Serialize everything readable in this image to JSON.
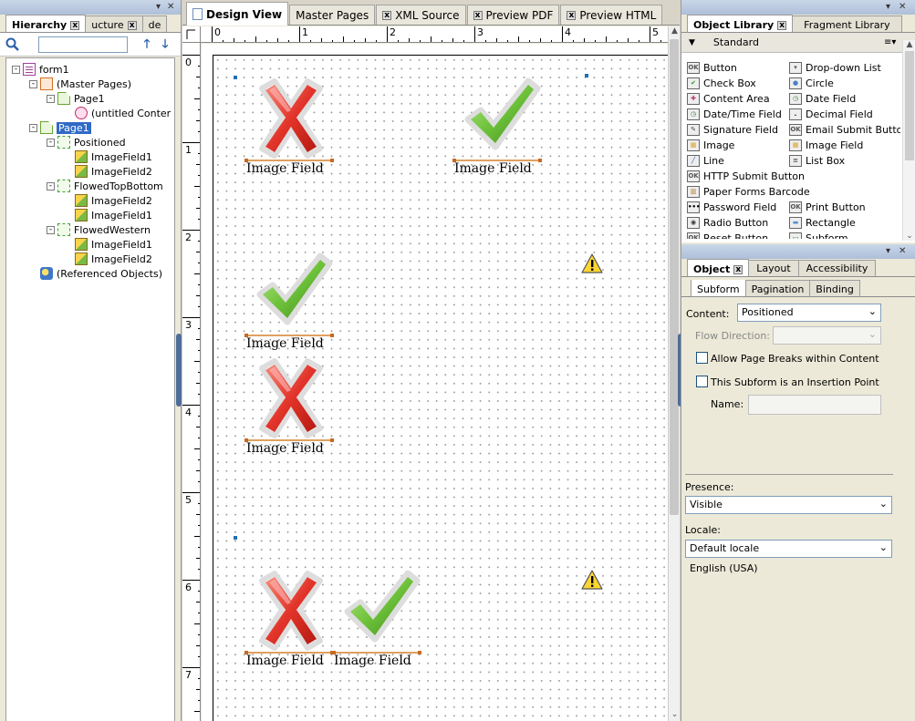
{
  "hierarchy_panel": {
    "tabs": [
      {
        "label": "Hierarchy",
        "closable": true,
        "active": true
      },
      {
        "label": "ucture",
        "closable": true,
        "active": false
      },
      {
        "label": "de",
        "closable": false,
        "active": false
      }
    ],
    "tree": [
      {
        "label": "form1",
        "icon": "form-icon",
        "toggle": "-",
        "depth": 0
      },
      {
        "label": "(Master Pages)",
        "icon": "master-pages-icon",
        "toggle": "-",
        "depth": 1
      },
      {
        "label": "Page1",
        "icon": "page-icon",
        "toggle": "-",
        "depth": 2
      },
      {
        "label": "(untitled Conter",
        "icon": "content-area-icon",
        "toggle": "",
        "depth": 3
      },
      {
        "label": "Page1",
        "icon": "page-icon",
        "toggle": "-",
        "depth": 1,
        "selected": true
      },
      {
        "label": "Positioned",
        "icon": "subform-icon",
        "toggle": "-",
        "depth": 2
      },
      {
        "label": "ImageField1",
        "icon": "image-field-icon",
        "toggle": "",
        "depth": 3
      },
      {
        "label": "ImageField2",
        "icon": "image-field-icon",
        "toggle": "",
        "depth": 3
      },
      {
        "label": "FlowedTopBottom",
        "icon": "subform-icon",
        "toggle": "-",
        "depth": 2
      },
      {
        "label": "ImageField2",
        "icon": "image-field-icon",
        "toggle": "",
        "depth": 3
      },
      {
        "label": "ImageField1",
        "icon": "image-field-icon",
        "toggle": "",
        "depth": 3
      },
      {
        "label": "FlowedWestern",
        "icon": "subform-icon",
        "toggle": "-",
        "depth": 2
      },
      {
        "label": "ImageField1",
        "icon": "image-field-icon",
        "toggle": "",
        "depth": 3
      },
      {
        "label": "ImageField2",
        "icon": "image-field-icon",
        "toggle": "",
        "depth": 3
      },
      {
        "label": "(Referenced Objects)",
        "icon": "referenced-objects-icon",
        "toggle": "",
        "depth": 1
      }
    ]
  },
  "doc_tabs": [
    {
      "label": "Design View",
      "active": true,
      "icon": "page-icon",
      "closable": false
    },
    {
      "label": "Master Pages",
      "active": false,
      "closable": false
    },
    {
      "label": "XML Source",
      "active": false,
      "closable": true
    },
    {
      "label": "Preview PDF",
      "active": false,
      "closable": true
    },
    {
      "label": "Preview HTML",
      "active": false,
      "closable": true
    }
  ],
  "rulers": {
    "horizontal": [
      "0",
      "1",
      "2",
      "3",
      "4",
      "5"
    ],
    "vertical": [
      "0",
      "1",
      "2",
      "3",
      "4",
      "5",
      "6",
      "7"
    ]
  },
  "canvas": {
    "fields": [
      {
        "caption": "Image Field",
        "image": "red-x"
      },
      {
        "caption": "Image Field",
        "image": "green-check"
      },
      {
        "caption": "Image Field",
        "image": "green-check"
      },
      {
        "caption": "Image Field",
        "image": "red-x"
      },
      {
        "caption": "Image Field",
        "image": "red-x"
      },
      {
        "caption": "Image Field",
        "image": "green-check"
      }
    ]
  },
  "object_library": {
    "tabs": [
      {
        "label": "Object Library",
        "active": true,
        "closable": true
      },
      {
        "label": "Fragment Library",
        "active": false,
        "closable": false
      }
    ],
    "group": "Standard",
    "items": [
      [
        "Button",
        "Drop-down List"
      ],
      [
        "Check Box",
        "Circle"
      ],
      [
        "Content Area",
        "Date Field"
      ],
      [
        "Date/Time Field",
        "Decimal Field"
      ],
      [
        "Signature Field",
        "Email Submit Button"
      ],
      [
        "Image",
        "Image Field"
      ],
      [
        "Line",
        "List Box"
      ],
      [
        "HTTP Submit Button",
        ""
      ],
      [
        "Paper Forms Barcode",
        ""
      ],
      [
        "Password Field",
        "Print Button"
      ],
      [
        "Radio Button",
        "Rectangle"
      ],
      [
        "Reset Button",
        "Subform"
      ]
    ],
    "item_icons": [
      [
        "OK",
        "▾"
      ],
      [
        "✔",
        "●"
      ],
      [
        "✚",
        "◷"
      ],
      [
        "◷",
        "."
      ],
      [
        "✎",
        "OK"
      ],
      [
        "▦",
        "▦"
      ],
      [
        "╱",
        "≡"
      ],
      [
        "OK",
        ""
      ],
      [
        "▥",
        ""
      ],
      [
        "•••",
        "OK"
      ],
      [
        "◉",
        "▬"
      ],
      [
        "OK",
        "▭"
      ]
    ]
  },
  "properties": {
    "tabs": [
      {
        "label": "Object",
        "active": true,
        "closable": true
      },
      {
        "label": "Layout",
        "active": false
      },
      {
        "label": "Accessibility",
        "active": false
      }
    ],
    "subtabs": [
      {
        "label": "Subform",
        "active": true
      },
      {
        "label": "Pagination",
        "active": false
      },
      {
        "label": "Binding",
        "active": false
      }
    ],
    "content_label": "Content:",
    "content_value": "Positioned",
    "flow_direction_label": "Flow Direction:",
    "flow_direction_value": "",
    "allow_page_breaks_label": "Allow Page Breaks within Content",
    "insertion_point_label": "This Subform is an Insertion Point",
    "name_label": "Name:",
    "name_value": "",
    "presence_label": "Presence:",
    "presence_value": "Visible",
    "locale_label": "Locale:",
    "locale_value": "Default locale",
    "locale_note": "English (USA)"
  }
}
